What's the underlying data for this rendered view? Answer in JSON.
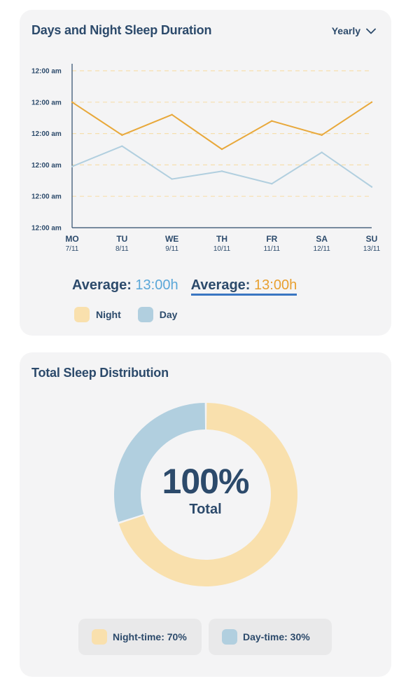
{
  "sleep_card": {
    "title": "Days and Night Sleep Duration",
    "range": "Yearly",
    "y_ticks": [
      "12:00 am",
      "12:00 am",
      "12:00 am",
      "12:00 am",
      "12:00 am",
      "12:00 am"
    ],
    "days": [
      {
        "day": "MO",
        "date": "7/11"
      },
      {
        "day": "TU",
        "date": "8/11"
      },
      {
        "day": "WE",
        "date": "9/11"
      },
      {
        "day": "TH",
        "date": "10/11"
      },
      {
        "day": "FR",
        "date": "11/11"
      },
      {
        "day": "SA",
        "date": "12/11"
      },
      {
        "day": "SU",
        "date": "13/11"
      }
    ],
    "average_day_label": "Average:",
    "average_day_value": "13:00h",
    "average_night_label": "Average:",
    "average_night_value": "13:00h",
    "legend": [
      {
        "label": "Night",
        "color": "#f9e0ad"
      },
      {
        "label": "Day",
        "color": "#b1cfdf"
      }
    ]
  },
  "chart_data": {
    "type": "line",
    "categories": [
      "MO",
      "TU",
      "WE",
      "TH",
      "FR",
      "SA",
      "SU"
    ],
    "ylim": [
      0,
      5
    ],
    "series": [
      {
        "name": "Night",
        "color": "#e8a83a",
        "values": [
          4.0,
          2.95,
          3.6,
          2.5,
          3.4,
          2.95,
          4.0
        ]
      },
      {
        "name": "Day",
        "color": "#b1cfdf",
        "values": [
          1.95,
          2.6,
          1.55,
          1.8,
          1.4,
          2.4,
          1.3
        ]
      }
    ]
  },
  "distribution_card": {
    "title": "Total Sleep Distribution",
    "total_value": "100%",
    "total_label": "Total",
    "segments": [
      {
        "label": "Night-time: 70%",
        "value": 70,
        "color": "#f9e0ad"
      },
      {
        "label": "Day-time: 30%",
        "value": 30,
        "color": "#b1cfdf"
      }
    ]
  },
  "colors": {
    "card_bg": "#f4f4f5",
    "text": "#2c4a6b",
    "night": "#f9e0ad",
    "day": "#b1cfdf",
    "night_line": "#e8a83a",
    "accent_blue": "#5aa7d8",
    "accent_orange": "#e8a030",
    "grid": "#f6dfae"
  }
}
